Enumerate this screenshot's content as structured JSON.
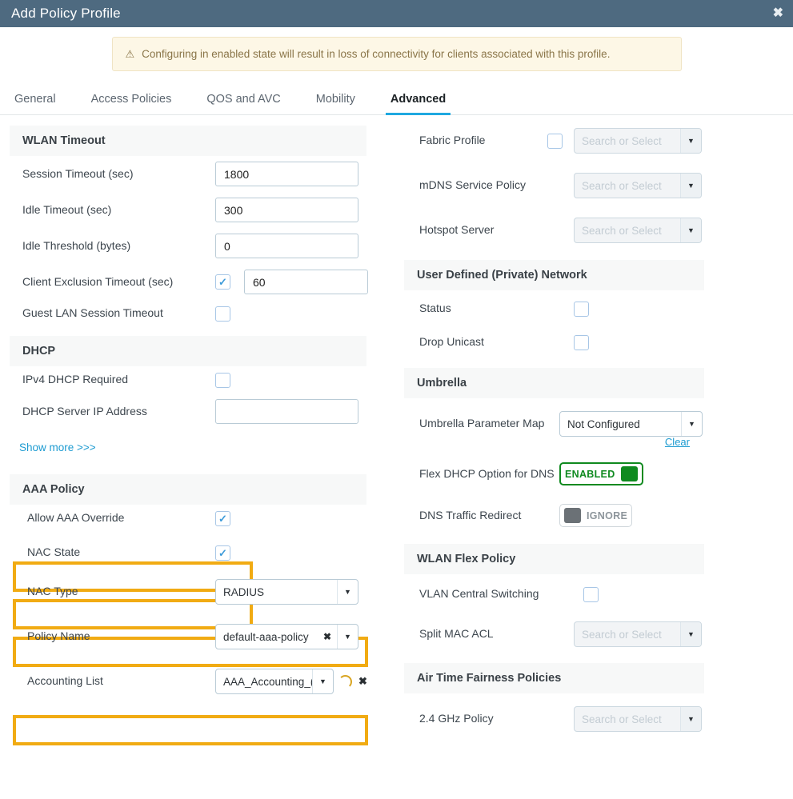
{
  "window": {
    "title": "Add Policy Profile",
    "close_label": "✖",
    "accent_header": "#4e6a80"
  },
  "banner": {
    "icon": "warning-triangle-icon",
    "glyph": "⚠",
    "text": "Configuring in enabled state will result in loss of connectivity for clients associated with this profile.",
    "bg": "#fdf7e6",
    "text_color": "#8a7548"
  },
  "tabs": [
    {
      "label": "General",
      "active": false
    },
    {
      "label": "Access Policies",
      "active": false
    },
    {
      "label": "QOS and AVC",
      "active": false
    },
    {
      "label": "Mobility",
      "active": false
    },
    {
      "label": "Advanced",
      "active": true
    }
  ],
  "tab_accent": "#1fa8e0",
  "highlight_color": "#f1ab13",
  "left": {
    "wlan_timeout": {
      "heading": "WLAN Timeout",
      "session_timeout_label": "Session Timeout (sec)",
      "session_timeout_value": "1800",
      "idle_timeout_label": "Idle Timeout (sec)",
      "idle_timeout_value": "300",
      "idle_threshold_label": "Idle Threshold (bytes)",
      "idle_threshold_value": "0",
      "client_exclusion_label": "Client Exclusion Timeout (sec)",
      "client_exclusion_checked": true,
      "client_exclusion_value": "60",
      "guest_lan_label": "Guest LAN Session Timeout",
      "guest_lan_checked": false
    },
    "dhcp": {
      "heading": "DHCP",
      "ipv4_required_label": "IPv4 DHCP Required",
      "ipv4_required_checked": false,
      "server_ip_label": "DHCP Server IP Address",
      "server_ip_value": ""
    },
    "show_more_label": "Show more >>>",
    "aaa": {
      "heading": "AAA Policy",
      "allow_override_label": "Allow AAA Override",
      "allow_override_checked": true,
      "nac_state_label": "NAC State",
      "nac_state_checked": true,
      "nac_type_label": "NAC Type",
      "nac_type_value": "RADIUS",
      "policy_name_label": "Policy Name",
      "policy_name_value": "default-aaa-policy",
      "policy_name_clear": "✖",
      "accounting_list_label": "Accounting List",
      "accounting_list_value": "AAA_Accounting_(",
      "accounting_list_remove": "✖"
    }
  },
  "right": {
    "fabric_profile_label": "Fabric Profile",
    "fabric_profile_checked": false,
    "fabric_profile_placeholder": "Search or Select",
    "mdns_label": "mDNS Service Policy",
    "mdns_placeholder": "Search or Select",
    "hotspot_label": "Hotspot Server",
    "hotspot_placeholder": "Search or Select",
    "udn": {
      "heading": "User Defined (Private) Network",
      "status_label": "Status",
      "status_checked": false,
      "drop_unicast_label": "Drop Unicast",
      "drop_unicast_checked": false
    },
    "umbrella": {
      "heading": "Umbrella",
      "param_map_label": "Umbrella Parameter Map",
      "param_map_value": "Not Configured",
      "clear_label": "Clear",
      "flex_dhcp_label": "Flex DHCP Option for DNS",
      "flex_dhcp_state": "ENABLED",
      "dns_redirect_label": "DNS Traffic Redirect",
      "dns_redirect_state": "IGNORE",
      "enabled_color": "#0f8a1f"
    },
    "wlan_flex": {
      "heading": "WLAN Flex Policy",
      "vlan_central_label": "VLAN Central Switching",
      "vlan_central_checked": false,
      "split_mac_label": "Split MAC ACL",
      "split_mac_placeholder": "Search or Select"
    },
    "atf": {
      "heading": "Air Time Fairness Policies",
      "ghz24_label": "2.4 GHz Policy",
      "ghz24_placeholder": "Search or Select"
    }
  }
}
